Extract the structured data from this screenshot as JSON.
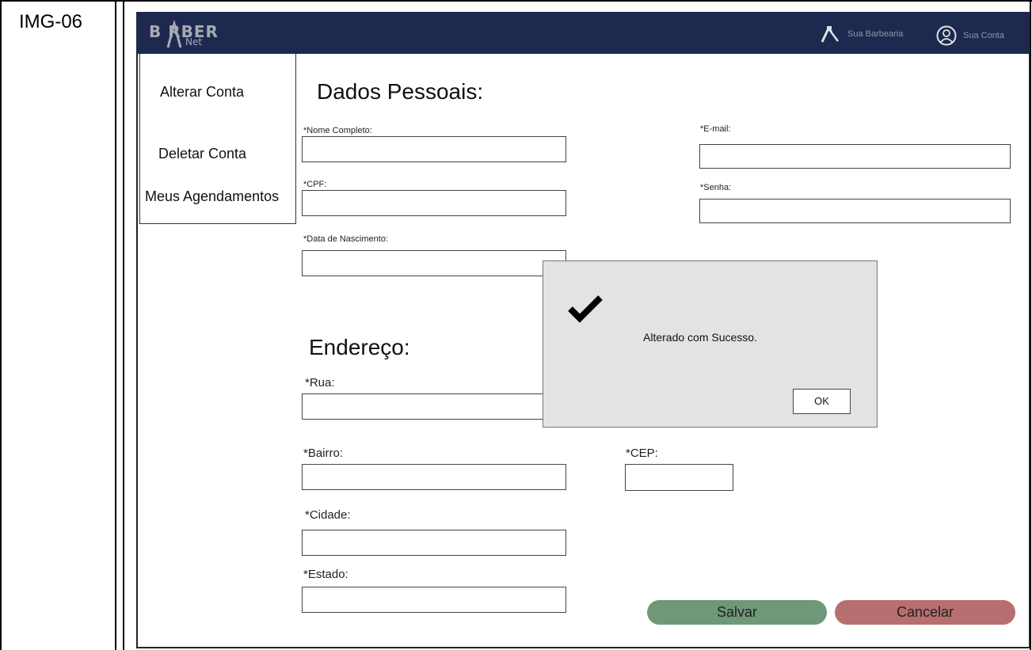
{
  "image_label": "IMG-06",
  "header": {
    "logo_text": "B RBER",
    "logo_sub": "Net",
    "nav": [
      {
        "label": "Sua Barbearia",
        "icon": "razor-icon"
      },
      {
        "label": "Sua Conta",
        "icon": "user-circle-icon"
      }
    ],
    "bg_color": "#1e2950"
  },
  "sidebar": {
    "items": [
      {
        "label": "Alterar Conta"
      },
      {
        "label": "Deletar Conta"
      },
      {
        "label": "Meus Agendamentos"
      }
    ]
  },
  "personal": {
    "title": "Dados Pessoais:",
    "fields": {
      "nome": {
        "label": "*Nome Completo:",
        "value": ""
      },
      "cpf": {
        "label": "*CPF:",
        "value": ""
      },
      "nascimento": {
        "label": "*Data de Nascimento:",
        "value": ""
      },
      "email": {
        "label": "*E-mail:",
        "value": ""
      },
      "senha": {
        "label": "*Senha:",
        "value": ""
      }
    }
  },
  "address": {
    "title": "Endereço:",
    "fields": {
      "rua": {
        "label": "*Rua:",
        "value": ""
      },
      "bairro": {
        "label": "*Bairro:",
        "value": ""
      },
      "cep": {
        "label": "*CEP:",
        "value": ""
      },
      "cidade": {
        "label": "*Cidade:",
        "value": ""
      },
      "estado": {
        "label": "*Estado:",
        "value": ""
      }
    }
  },
  "actions": {
    "save_label": "Salvar",
    "cancel_label": "Cancelar",
    "save_color": "#6e9877",
    "cancel_color": "#b86e6e"
  },
  "dialog": {
    "icon": "checkmark-icon",
    "message": "Alterado com Sucesso.",
    "ok_label": "OK"
  }
}
